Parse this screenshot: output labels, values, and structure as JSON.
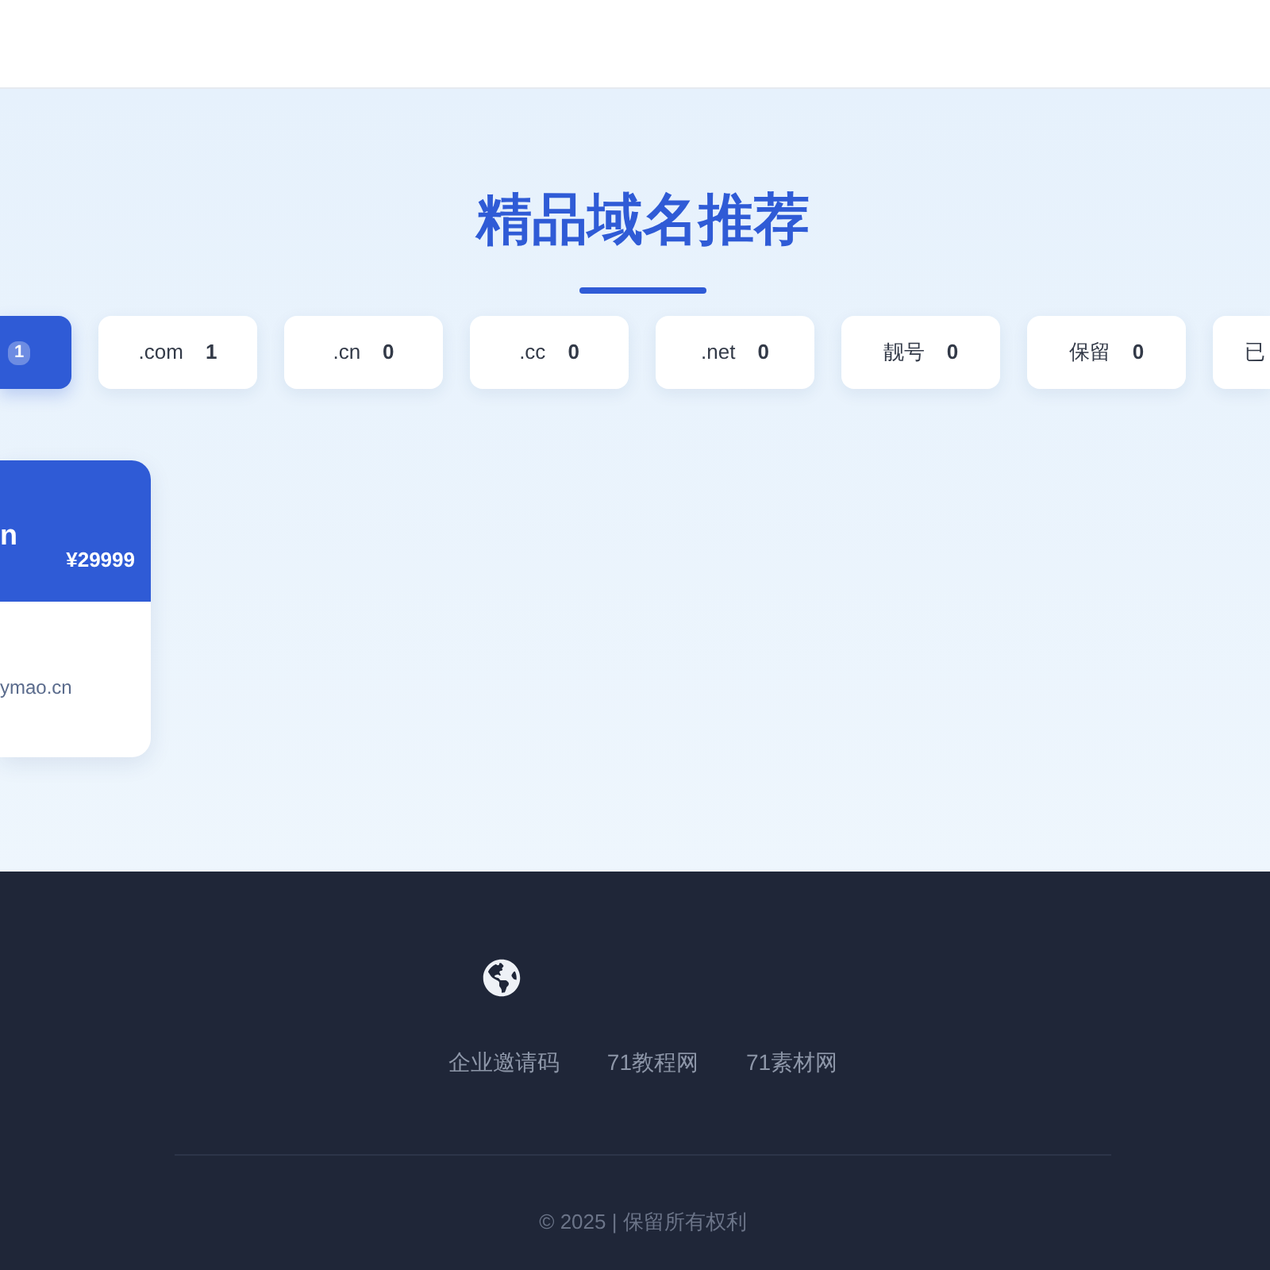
{
  "section": {
    "title": "精品域名推荐"
  },
  "tabs": [
    {
      "count": "1",
      "selected": true
    },
    {
      "label": ".com",
      "count": "1",
      "selected": false
    },
    {
      "label": ".cn",
      "count": "0",
      "selected": false
    },
    {
      "label": ".cc",
      "count": "0",
      "selected": false
    },
    {
      "label": ".net",
      "count": "0",
      "selected": false
    },
    {
      "label": "靓号",
      "count": "0",
      "selected": false
    },
    {
      "label": "保留",
      "count": "0",
      "selected": false
    },
    {
      "label": "已",
      "selected": false
    }
  ],
  "domains": [
    {
      "name": "n",
      "price": "¥29999",
      "url": "ymao.cn"
    }
  ],
  "footer": {
    "links": [
      "企业邀请码",
      "71教程网",
      "71素材网"
    ],
    "copyright": "© 2025 | 保留所有权利"
  }
}
